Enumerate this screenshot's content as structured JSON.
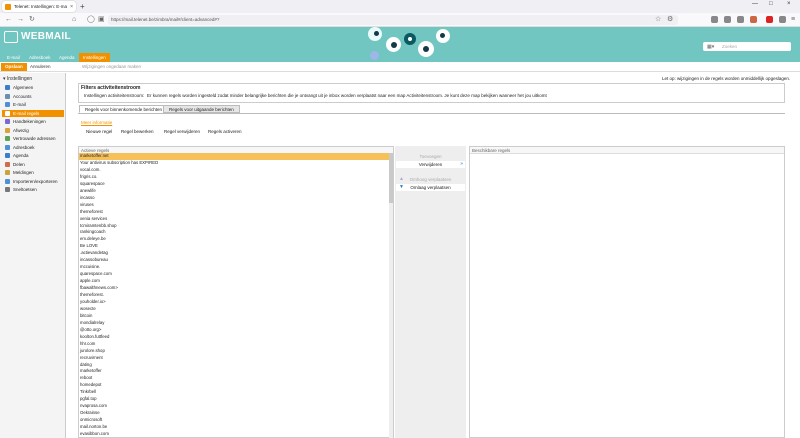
{
  "browser": {
    "tab_title": "Telenet: Instellingen: E-mail re",
    "tab_close": "×",
    "new_tab": "+",
    "url": "https://mail.telenet.be/zimbra/mail#/client=advanced#?",
    "window_controls": [
      "—",
      "□",
      "×"
    ]
  },
  "app": {
    "logo": "WEBMAIL",
    "search_placeholder": "Zoeken",
    "main_nav": [
      "E-mail",
      "Adresboek",
      "Agenda",
      "Instellingen"
    ],
    "active_nav": "Instellingen"
  },
  "toolbar": {
    "save_label": "Opslaan",
    "cancel_label": "Annuleren",
    "page_options": "Wijzigingen ongedaan maken"
  },
  "sidebar": {
    "title": "Instellingen",
    "items": [
      {
        "label": "Algemeen",
        "color": "#3a7dc9"
      },
      {
        "label": "Accounts",
        "color": "#6a8fb3"
      },
      {
        "label": "E-mail",
        "color": "#4f8fd6"
      },
      {
        "label": "E-mail regels",
        "color": "#f29100",
        "active": true
      },
      {
        "label": "Handtekeningen",
        "color": "#7a6ad0"
      },
      {
        "label": "Afwezig",
        "color": "#d9a23a"
      },
      {
        "label": "Vertrouwde adressen",
        "color": "#5aa357"
      },
      {
        "label": "Adresboek",
        "color": "#4f8fd6"
      },
      {
        "label": "Agenda",
        "color": "#3a7dc9"
      },
      {
        "label": "Delen",
        "color": "#d16b4a"
      },
      {
        "label": "Meldingen",
        "color": "#c9a43a"
      },
      {
        "label": "Importeren/exporteren",
        "color": "#4f8fd6"
      },
      {
        "label": "Sneltoetsen",
        "color": "#777777"
      }
    ]
  },
  "content": {
    "tip": "Let op: wijzigingen in de regels worden onmiddellijk opgeslagen.",
    "section_title": "Filters activiteitenstroom",
    "section_label": "Instellingen activiteitenstroom:",
    "section_desc": "Er kunnen regels worden ingesteld zodat minder belangrijke berichten die je ontvangt uit je inbox worden verplaatst naar een map Activiteitenstroom. Je kunt deze map bekijken wanneer het jou uitkomt",
    "tabs": [
      "Regels voor binnenkomende berichten",
      "Regels voor uitgaande berichten"
    ],
    "more_info": "Meer informatie",
    "tools": [
      "Nieuwe regel",
      "Regel bewerken",
      "Regel verwijderen",
      "Regels activeren"
    ],
    "active_rules_header": "Actieve regels",
    "available_rules_header": "Beschikbare regels",
    "mid_buttons": [
      {
        "label": "Toevoegen",
        "enabled": false
      },
      {
        "label": "Verwijderen",
        "enabled": true
      },
      {
        "label": "Omhoog verplaatsen",
        "enabled": false
      },
      {
        "label": "Omlaag verplaatsen",
        "enabled": true
      }
    ],
    "active_rules": [
      "marketoffer.net",
      "Your antivirus subscription has EXPIRED",
      "vocal.com.",
      "frigris.co.",
      "squarespace",
      "anewlife",
      "incasso",
      "viruses",
      "themeforest",
      "xenia services",
      "tcmiramtenbb.shop",
      "rankingcoach",
      "em.deleye.be",
      "Be LOVE",
      ".actievandetag",
      "incassobureau",
      "mccuisine.",
      "quarespace.com",
      "apple.com",
      "fbawalthnews.com>",
      "themeforest.",
      "youholder.io>",
      "wosecte",
      "bitcoin",
      "mondialrelay",
      "@otto.org>",
      "koolton.futtfeed",
      "hhr.com",
      "jurolore.shop",
      "recruvirnent",
      "dating",
      "marketoffer",
      "reboot",
      "homedepot",
      "Tinkrbell",
      "pgfal.top",
      "nvaprosa.com",
      "Oekrainse",
      "onmicrosoft",
      "mail.norton.be",
      "evasibbon.com"
    ]
  }
}
